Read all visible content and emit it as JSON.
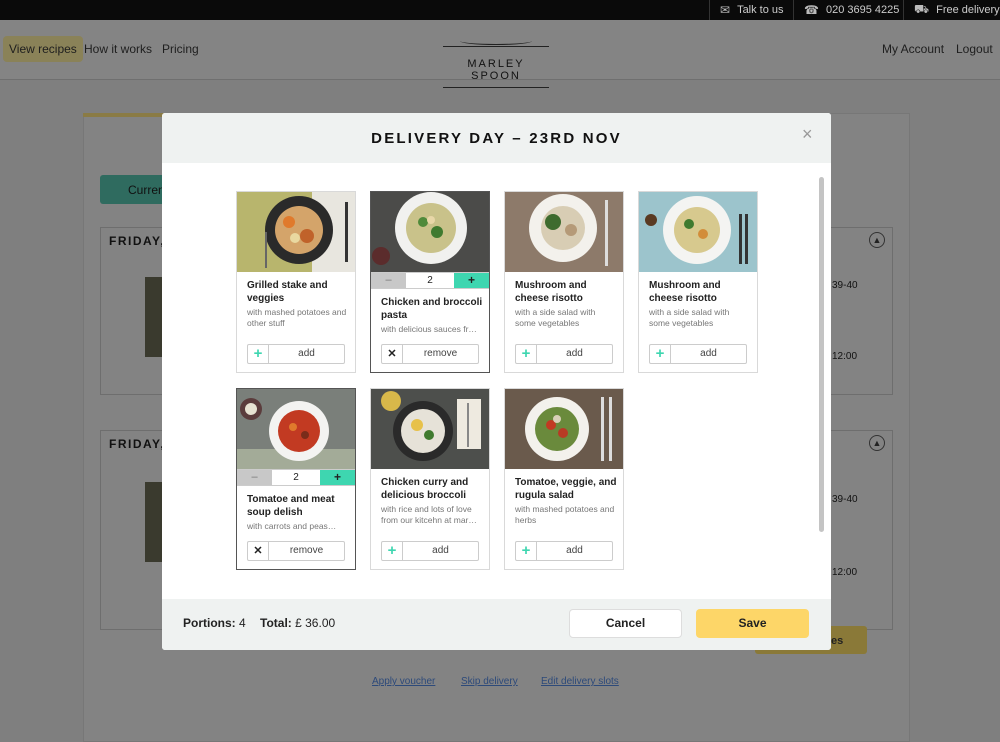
{
  "topbar": {
    "talk": "Talk to us",
    "phone": "020 3695 4225",
    "delivery": "Free delivery"
  },
  "nav": {
    "view_recipes": "View recipes",
    "how_it_works": "How it works",
    "pricing": "Pricing",
    "logo": "MARLEY SPOON",
    "my_account": "My Account",
    "logout": "Logout"
  },
  "background": {
    "tab": "Curren",
    "section1": "FRIDAY,",
    "section2": "FRIDAY,",
    "time1": "39-40",
    "time2": "12:00",
    "time3": "39-40",
    "time4": "12:00",
    "btn": "es",
    "apply_voucher": "Apply voucher",
    "skip_delivery": "Skip delivery",
    "edit_slots": "Edit delivery slots"
  },
  "modal": {
    "title": "DELIVERY DAY – 23RD NOV",
    "close": "×",
    "cards": [
      {
        "name": "Grilled stake and veggies",
        "desc": "with mashed potatoes and other stuff",
        "action": "add",
        "selected": false
      },
      {
        "name": "Chicken and broccoli pasta",
        "desc": "with delicious sauces fr…",
        "action": "remove",
        "selected": true,
        "qty": "2"
      },
      {
        "name": "Mushroom and cheese risotto",
        "desc": "with a side salad with some vegetables",
        "action": "add",
        "selected": false
      },
      {
        "name": "Mushroom and cheese risotto",
        "desc": "with a side salad with some vegetables",
        "action": "add",
        "selected": false
      },
      {
        "name": "Tomatoe and meat soup delish",
        "desc": "with carrots and peas…",
        "action": "remove",
        "selected": true,
        "qty": "2"
      },
      {
        "name": "Chicken curry and delicious broccoli",
        "desc": "with rice and lots of love from our kitcehn at mar…",
        "action": "add",
        "selected": false
      },
      {
        "name": "Tomatoe, veggie, and rugula salad",
        "desc": "with mashed potatoes and herbs",
        "action": "add",
        "selected": false
      }
    ],
    "footer": {
      "portions_label": "Portions:",
      "portions_value": "4",
      "total_label": "Total:",
      "total_value": "£ 36.00",
      "cancel": "Cancel",
      "save": "Save"
    }
  },
  "colors": {
    "accent_green": "#3ed6b0",
    "save_yellow": "#fdd668",
    "header_bg": "#eff2f1"
  }
}
